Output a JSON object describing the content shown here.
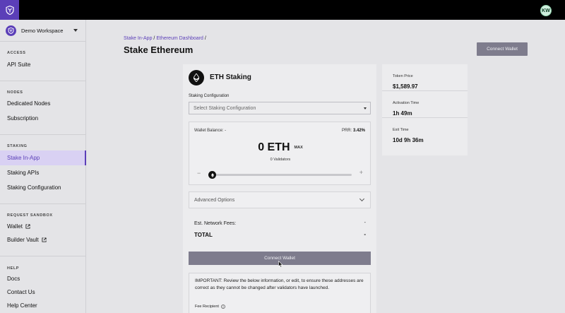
{
  "topbar": {
    "avatar_initials": "KW"
  },
  "sidebar": {
    "workspace": "Demo Workspace",
    "sections": {
      "access": "ACCESS",
      "nodes": "NODES",
      "staking": "STAKING",
      "sandbox": "REQUEST SANDBOX",
      "help": "HELP"
    },
    "items": {
      "api_suite": "API Suite",
      "dedicated_nodes": "Dedicated Nodes",
      "subscription": "Subscription",
      "stake_in_app": "Stake In-App",
      "staking_apis": "Staking APIs",
      "staking_configuration": "Staking Configuration",
      "wallet": "Wallet",
      "builder_vault": "Builder Vault",
      "docs": "Docs",
      "contact_us": "Contact Us",
      "help_center": "Help Center"
    }
  },
  "header": {
    "breadcrumb": [
      "Stake In-App",
      "Ethereum Dashboard"
    ],
    "breadcrumb_sep": "/",
    "title": "Stake Ethereum",
    "connect_button": "Connect Wallet"
  },
  "staking_card": {
    "title": "ETH Staking",
    "config_label": "Staking Configuration",
    "config_placeholder": "Select Staking Configuration",
    "wallet_balance": "Wallet Balance: -",
    "prr_label": "PRR:",
    "prr_value": "3.42%",
    "amount": "0 ETH",
    "max": "MAX",
    "validators": "0 Validators",
    "slider_minus": "−",
    "slider_plus": "+",
    "slider_value": 0,
    "advanced": "Advanced Options",
    "fees_label": "Est. Network Fees:",
    "fees_value": "-",
    "total_label": "TOTAL",
    "total_value": "-",
    "connect_button": "Connect Wallet",
    "notice": "IMPORTANT: Review the below information, or edit, to ensure these addresses are correct as they cannot be changed after validators have launched.",
    "fee_recipient": "Fee Recipient"
  },
  "token_info": {
    "price_label": "Token Price",
    "price_value": "$1,589.97",
    "activation_label": "Activation Time",
    "activation_value": "1h 49m",
    "exit_label": "Exit Time",
    "exit_value": "10d 9h 36m"
  },
  "colors": {
    "brand": "#5b3fb8",
    "button": "#7e7c8d",
    "background": "#e4e4e7"
  }
}
